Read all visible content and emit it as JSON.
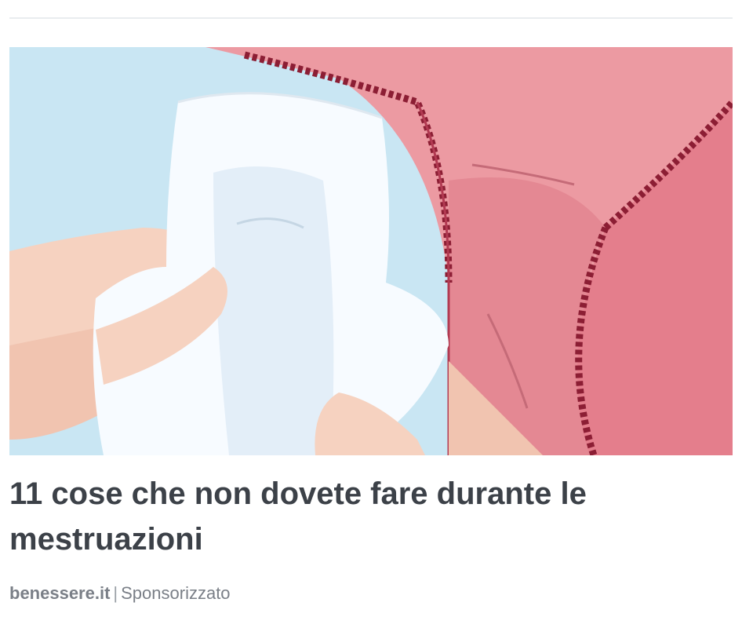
{
  "ad": {
    "headline": "11 cose che non dovete fare durante le mestruazioni",
    "source": "benessere.it",
    "separator": "|",
    "sponsored_label": "Sponsorizzato",
    "thumbnail": {
      "icon": "sanitary-pad-illustration",
      "description_colors": {
        "sky": "#c9e6f3",
        "fabric": "#ec9aa2",
        "fabric_dark": "#8c1e34",
        "skin": "#f6d2c0",
        "pad": "#f7fbff"
      }
    }
  },
  "colors": {
    "headline": "#3c4148",
    "meta": "#7a7f87",
    "divider": "#e9ecef"
  }
}
